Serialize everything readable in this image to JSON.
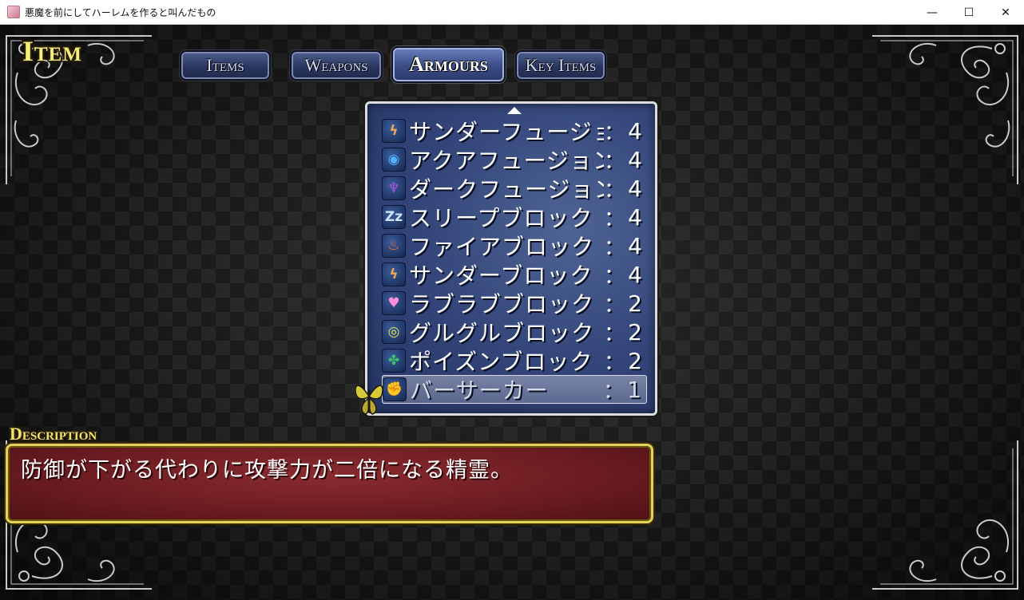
{
  "window": {
    "title": "悪魔を前にしてハーレムを作ると叫んだもの",
    "minimize": "—",
    "maximize": "☐",
    "close": "✕"
  },
  "scene": {
    "title": "Item"
  },
  "tabs": [
    {
      "label": "Items",
      "active": false
    },
    {
      "label": "Weapons",
      "active": false
    },
    {
      "label": "Armours",
      "active": true
    },
    {
      "label": "Key Items",
      "active": false
    }
  ],
  "list": {
    "colon": "：",
    "items": [
      {
        "name": "サンダーフュージョン",
        "count": "4",
        "icon": "thunder-icon",
        "glyph": "ϟ",
        "color": "#f2a65a"
      },
      {
        "name": "アクアフュージョン",
        "count": "4",
        "icon": "water-icon",
        "glyph": "◉",
        "color": "#4fb3ff"
      },
      {
        "name": "ダークフュージョン",
        "count": "4",
        "icon": "dark-icon",
        "glyph": "♆",
        "color": "#b050d8"
      },
      {
        "name": "スリープブロック",
        "count": "4",
        "icon": "sleep-icon",
        "glyph": "Zz",
        "color": "#cfe3ff"
      },
      {
        "name": "ファイアブロック",
        "count": "4",
        "icon": "fire-icon",
        "glyph": "♨",
        "color": "#ff6a2a"
      },
      {
        "name": "サンダーブロック",
        "count": "4",
        "icon": "thunder-icon",
        "glyph": "ϟ",
        "color": "#f2a65a"
      },
      {
        "name": "ラブラブブロック",
        "count": "2",
        "icon": "heart-icon",
        "glyph": "♥",
        "color": "#ff8fd8"
      },
      {
        "name": "グルグルブロック",
        "count": "2",
        "icon": "spiral-icon",
        "glyph": "◎",
        "color": "#e6e24a"
      },
      {
        "name": "ポイズンブロック",
        "count": "2",
        "icon": "poison-icon",
        "glyph": "✤",
        "color": "#3fbf6a"
      },
      {
        "name": "バーサーカー",
        "count": "1",
        "icon": "fist-icon",
        "glyph": "✊",
        "color": "#bfe0ff",
        "selected": true
      }
    ]
  },
  "description": {
    "label": "Description",
    "text": "防御が下がる代わりに攻撃力が二倍になる精霊。"
  },
  "colors": {
    "accent_gold": "#f1e56a",
    "list_bg": "#34467a",
    "desc_bg": "#6d1d22"
  }
}
